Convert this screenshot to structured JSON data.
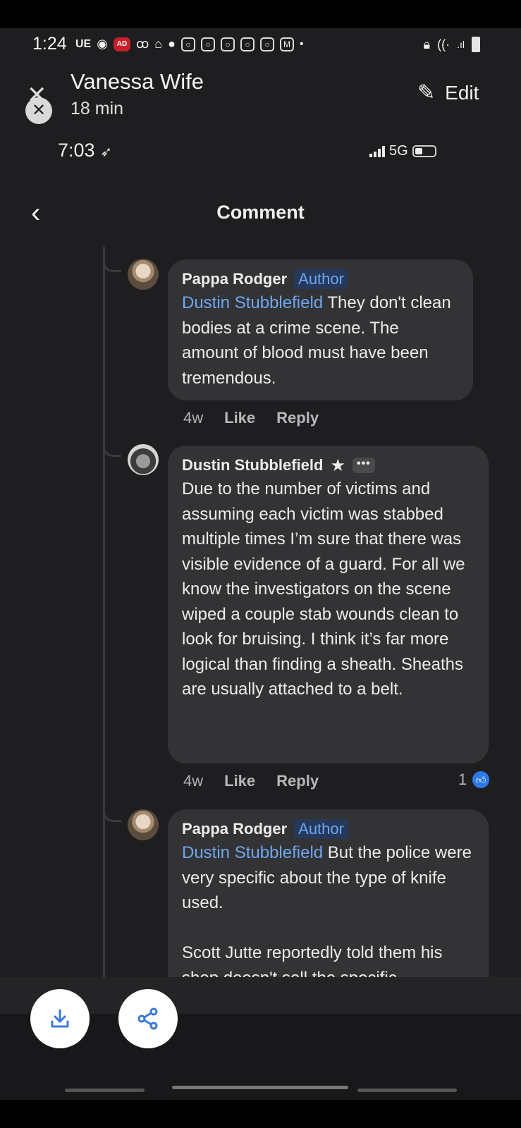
{
  "android_status": {
    "time": "1:24",
    "carrier_tag": "UE",
    "ad_badge": "AD"
  },
  "viewer": {
    "title": "Vanessa Wife",
    "subtitle": "18 min",
    "edit_label": "Edit"
  },
  "ios_status": {
    "time": "7:03",
    "network": "5G"
  },
  "page": {
    "title": "Comment"
  },
  "comments": [
    {
      "author": "Pappa Rodger",
      "badge": "Author",
      "mention": "Dustin Stubblefield",
      "text": " They don't clean bodies at a crime scene. The amount of blood must have been tremendous.",
      "time": "4w",
      "like": "Like",
      "reply": "Reply"
    },
    {
      "author": "Dustin Stubblefield",
      "badge_icon": "star-icon",
      "more": "•••",
      "text": "Due to the number of victims and assuming each victim was stabbed multiple times I’m sure that there was visible evidence of a guard. For all we know the investigators on the scene wiped a couple stab wounds clean to look for bruising. I think it’s far more logical than finding a sheath. Sheaths are usually attached to a belt.",
      "time": "4w",
      "like": "Like",
      "reply": "Reply",
      "reaction_count": "1"
    },
    {
      "author": "Pappa Rodger",
      "badge": "Author",
      "mention": "Dustin Stubblefield",
      "text": " But the police were very specific about the type of knife used.\n\nScott Jutte reportedly told them his shop doesn't sell the specific"
    }
  ],
  "colors": {
    "background": "#1e1e20",
    "bubble": "#333335",
    "mention": "#6ea6f0",
    "like_blue": "#2f79e6"
  }
}
